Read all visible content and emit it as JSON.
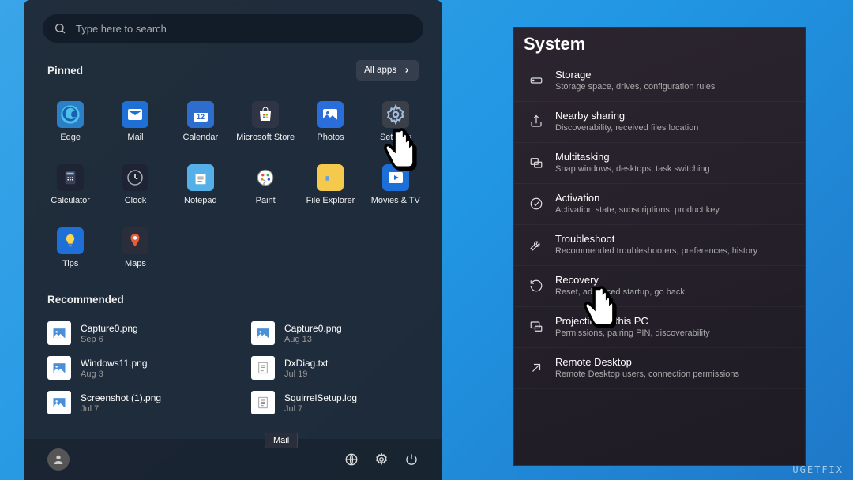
{
  "search": {
    "placeholder": "Type here to search"
  },
  "pinned_header": "Pinned",
  "all_apps_label": "All apps",
  "pinned": [
    {
      "label": "Edge",
      "fill": "#2b7fc7",
      "svg": "edge"
    },
    {
      "label": "Mail",
      "fill": "#1e6fd6",
      "svg": "mail"
    },
    {
      "label": "Calendar",
      "fill": "#2d6dce",
      "svg": "calendar"
    },
    {
      "label": "Microsoft Store",
      "fill": "#2f3544",
      "svg": "store"
    },
    {
      "label": "Photos",
      "fill": "#2a6edb",
      "svg": "photos"
    },
    {
      "label": "Settings",
      "fill": "#3a3f48",
      "svg": "gear"
    },
    {
      "label": "Calculator",
      "fill": "#1e2433",
      "svg": "calc"
    },
    {
      "label": "Clock",
      "fill": "#1e2433",
      "svg": "clock"
    },
    {
      "label": "Notepad",
      "fill": "#55b0e8",
      "svg": "notepad"
    },
    {
      "label": "Paint",
      "fill": "#ffffff",
      "svg": "paint"
    },
    {
      "label": "File Explorer",
      "fill": "#f5c94b",
      "svg": "folder"
    },
    {
      "label": "Movies & TV",
      "fill": "#1d6fd8",
      "svg": "movie"
    },
    {
      "label": "Tips",
      "fill": "#1e6fd8",
      "svg": "bulb"
    },
    {
      "label": "Maps",
      "fill": "#2a2e3a",
      "svg": "pin"
    }
  ],
  "recommended_header": "Recommended",
  "recommended": [
    {
      "title": "Capture0.png",
      "date": "Sep 6",
      "type": "image"
    },
    {
      "title": "Capture0.png",
      "date": "Aug 13",
      "type": "image"
    },
    {
      "title": "Windows11.png",
      "date": "Aug 3",
      "type": "image"
    },
    {
      "title": "DxDiag.txt",
      "date": "Jul 19",
      "type": "text"
    },
    {
      "title": "Screenshot (1).png",
      "date": "Jul 7",
      "type": "image"
    },
    {
      "title": "SquirrelSetup.log",
      "date": "Jul 7",
      "type": "text"
    }
  ],
  "footer_tooltip": "Mail",
  "settings": {
    "title": "System",
    "items": [
      {
        "label": "Storage",
        "desc": "Storage space, drives, configuration rules",
        "icon": "storage"
      },
      {
        "label": "Nearby sharing",
        "desc": "Discoverability, received files location",
        "icon": "share"
      },
      {
        "label": "Multitasking",
        "desc": "Snap windows, desktops, task switching",
        "icon": "multitask"
      },
      {
        "label": "Activation",
        "desc": "Activation state, subscriptions, product key",
        "icon": "check"
      },
      {
        "label": "Troubleshoot",
        "desc": "Recommended troubleshooters, preferences, history",
        "icon": "wrench"
      },
      {
        "label": "Recovery",
        "desc": "Reset, advanced startup, go back",
        "icon": "recovery"
      },
      {
        "label": "Projecting to this PC",
        "desc": "Permissions, pairing PIN, discoverability",
        "icon": "project"
      },
      {
        "label": "Remote Desktop",
        "desc": "Remote Desktop users, connection permissions",
        "icon": "remote"
      }
    ]
  },
  "watermark": "UGETFIX"
}
